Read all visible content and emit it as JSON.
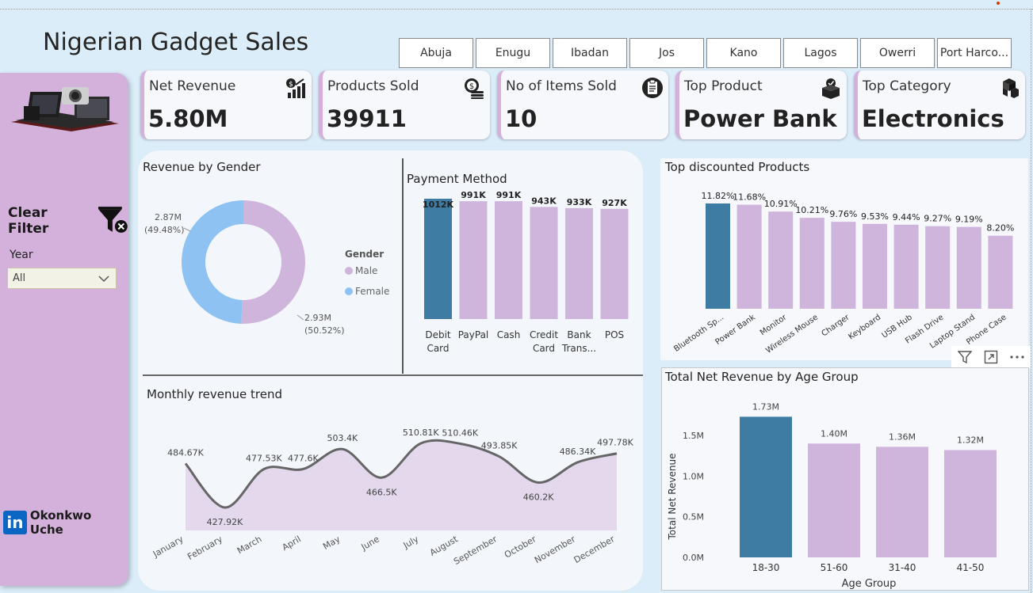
{
  "title": "Nigerian Gadget Sales",
  "cities": [
    "Abuja",
    "Enugu",
    "Ibadan",
    "Jos",
    "Kano",
    "Lagos",
    "Owerri",
    "Port Harco..."
  ],
  "sidebar": {
    "clear_filter": "Clear Filter",
    "year_label": "Year",
    "year_value": "All",
    "author": "Okonkwo Uche",
    "linkedin": "in"
  },
  "kpis": [
    {
      "label": "Net Revenue",
      "value": "5.80M",
      "icon": "revenue-chart-icon"
    },
    {
      "label": "Products Sold",
      "value": "39911",
      "icon": "coins-icon"
    },
    {
      "label": "No of Items Sold",
      "value": "10",
      "icon": "clipboard-icon"
    },
    {
      "label": "Top Product",
      "value": "Power Bank",
      "icon": "product-box-icon"
    },
    {
      "label": "Top Category",
      "value": "Electronics",
      "icon": "cubes-icon"
    }
  ],
  "colors": {
    "accent": "#3f7ca3",
    "purple": "#cfb4db",
    "blue_light": "#8dc2f2",
    "line": "#666666"
  },
  "charts": {
    "gender": {
      "title": "Revenue by Gender",
      "legend_title": "Gender",
      "slices": [
        {
          "name": "Male",
          "value": 2.93,
          "label": "2.93M",
          "pct": "(50.52%)",
          "share": 50.52,
          "color": "#cfb4db"
        },
        {
          "name": "Female",
          "value": 2.87,
          "label": "2.87M",
          "pct": "(49.48%)",
          "share": 49.48,
          "color": "#8dc2f2"
        }
      ]
    },
    "payment": {
      "title": "Payment Method",
      "categories": [
        [
          "Debit",
          "Card"
        ],
        [
          "PayPal"
        ],
        [
          "Cash"
        ],
        [
          "Credit",
          "Card"
        ],
        [
          "Bank",
          "Trans..."
        ],
        [
          "POS"
        ]
      ],
      "values": [
        1012,
        991,
        991,
        943,
        933,
        927
      ],
      "labels": [
        "1012K",
        "991K",
        "991K",
        "943K",
        "933K",
        "927K"
      ],
      "highlight": 0
    },
    "discount": {
      "title": "Top discounted Products",
      "categories": [
        "Bluetooth Sp...",
        "Power Bank",
        "Monitor",
        "Wireless Mouse",
        "Charger",
        "Keyboard",
        "USB Hub",
        "Flash Drive",
        "Laptop Stand",
        "Phone Case"
      ],
      "values": [
        11.82,
        11.68,
        10.91,
        10.21,
        9.76,
        9.53,
        9.44,
        9.27,
        9.19,
        8.2
      ],
      "labels": [
        "11.82%",
        "11.68%",
        "10.91%",
        "10.21%",
        "9.76%",
        "9.53%",
        "9.44%",
        "9.27%",
        "9.19%",
        "8.20%"
      ],
      "highlight": 0
    },
    "monthly": {
      "title": "Monthly revenue trend",
      "categories": [
        "January",
        "February",
        "March",
        "April",
        "May",
        "June",
        "July",
        "August",
        "September",
        "October",
        "November",
        "December"
      ],
      "values": [
        484.67,
        427.92,
        477.53,
        477.6,
        503.4,
        466.5,
        510.81,
        510.46,
        493.85,
        460.2,
        486.34,
        497.78
      ],
      "labels": [
        "484.67K",
        "427.92K",
        "477.53K",
        "477.6K",
        "503.4K",
        "466.5K",
        "510.81K",
        "510.46K",
        "493.85K",
        "460.2K",
        "486.34K",
        "497.78K"
      ]
    },
    "age": {
      "title": "Total Net Revenue by Age Group",
      "xlabel": "Age Group",
      "ylabel": "Total Net Revenue",
      "categories": [
        "18-30",
        "51-60",
        "31-40",
        "41-50"
      ],
      "values": [
        1.73,
        1.4,
        1.36,
        1.32
      ],
      "labels": [
        "1.73M",
        "1.40M",
        "1.36M",
        "1.32M"
      ],
      "ticks": [
        "0.0M",
        "0.5M",
        "1.0M",
        "1.5M"
      ],
      "ylim": [
        0,
        1.8
      ],
      "highlight": 0
    }
  },
  "chart_data": [
    {
      "type": "pie",
      "title": "Revenue by Gender",
      "categories": [
        "Male",
        "Female"
      ],
      "values": [
        2.93,
        2.87
      ]
    },
    {
      "type": "bar",
      "title": "Payment Method",
      "categories": [
        "Debit Card",
        "PayPal",
        "Cash",
        "Credit Card",
        "Bank Trans...",
        "POS"
      ],
      "values": [
        1012,
        991,
        991,
        943,
        933,
        927
      ]
    },
    {
      "type": "bar",
      "title": "Top discounted Products",
      "categories": [
        "Bluetooth Sp...",
        "Power Bank",
        "Monitor",
        "Wireless Mouse",
        "Charger",
        "Keyboard",
        "USB Hub",
        "Flash Drive",
        "Laptop Stand",
        "Phone Case"
      ],
      "values": [
        11.82,
        11.68,
        10.91,
        10.21,
        9.76,
        9.53,
        9.44,
        9.27,
        9.19,
        8.2
      ]
    },
    {
      "type": "area",
      "title": "Monthly revenue trend",
      "categories": [
        "January",
        "February",
        "March",
        "April",
        "May",
        "June",
        "July",
        "August",
        "September",
        "October",
        "November",
        "December"
      ],
      "values": [
        484.67,
        427.92,
        477.53,
        477.6,
        503.4,
        466.5,
        510.81,
        510.46,
        493.85,
        460.2,
        486.34,
        497.78
      ]
    },
    {
      "type": "bar",
      "title": "Total Net Revenue by Age Group",
      "xlabel": "Age Group",
      "ylabel": "Total Net Revenue",
      "categories": [
        "18-30",
        "51-60",
        "31-40",
        "41-50"
      ],
      "values": [
        1.73,
        1.4,
        1.36,
        1.32
      ],
      "ylim": [
        0,
        1.8
      ]
    }
  ]
}
